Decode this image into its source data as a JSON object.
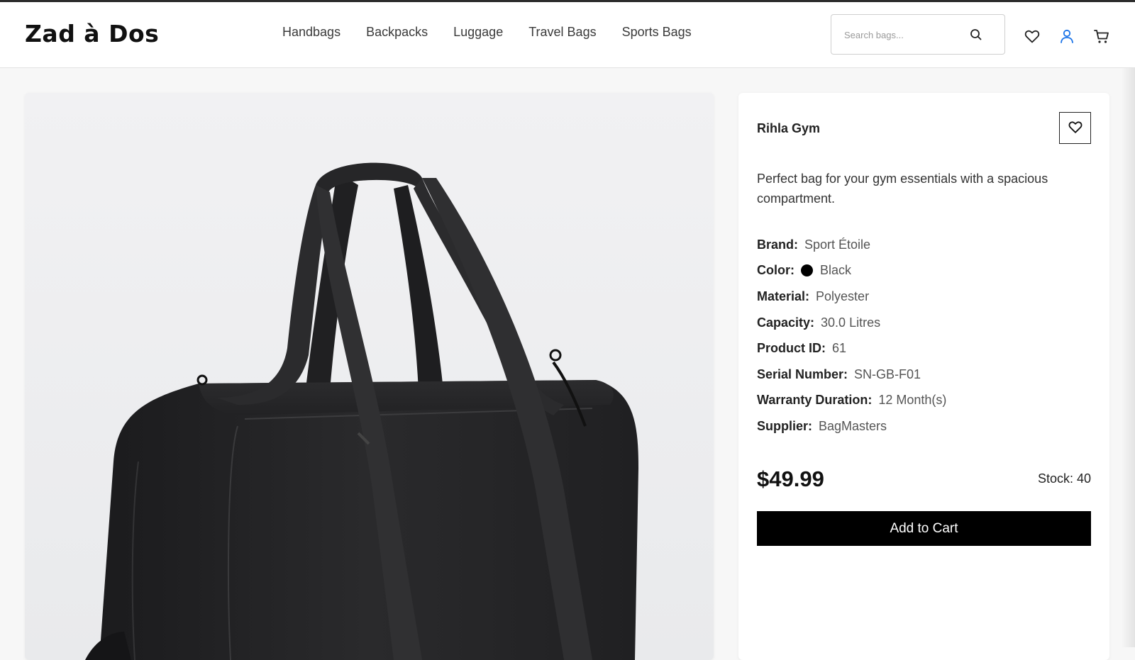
{
  "header": {
    "logo": "Zad à Dos",
    "nav": [
      "Handbags",
      "Backpacks",
      "Luggage",
      "Travel Bags",
      "Sports Bags"
    ],
    "search_placeholder": "Search bags...",
    "icons": [
      "search-icon",
      "heart-icon",
      "user-icon",
      "cart-icon"
    ]
  },
  "product": {
    "image_alt_icon": "duffle-bag-image",
    "title": "Rihla Gym",
    "description": "Perfect bag for your gym essentials with a spacious compartment.",
    "specs": {
      "brand_label": "Brand:",
      "brand": "Sport Étoile",
      "color_label": "Color:",
      "color": "Black",
      "color_hex": "#000000",
      "material_label": "Material:",
      "material": "Polyester",
      "capacity_label": "Capacity:",
      "capacity": "30.0 Litres",
      "pid_label": "Product ID:",
      "pid": "61",
      "serial_label": "Serial Number:",
      "serial": "SN-GB-F01",
      "warranty_label": "Warranty Duration:",
      "warranty": "12 Month(s)",
      "supplier_label": "Supplier:",
      "supplier": "BagMasters"
    },
    "price": "$49.99",
    "stock": "Stock: 40",
    "add_to_cart": "Add to Cart"
  },
  "colors": {
    "accent_user_icon": "#1a73e8",
    "button_bg": "#000000",
    "page_bg": "#f7f7f7"
  }
}
